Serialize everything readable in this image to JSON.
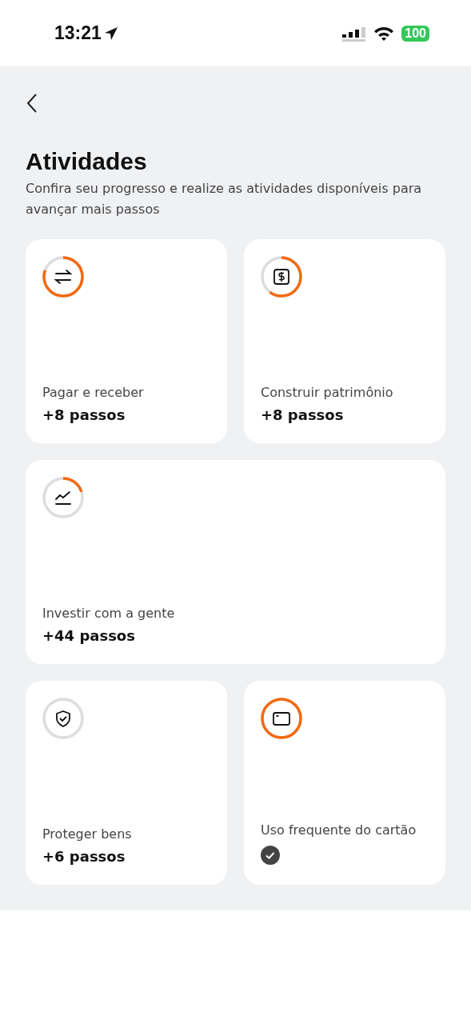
{
  "status_bar": {
    "time": "13:21",
    "battery": "100"
  },
  "header": {
    "title": "Atividades",
    "subtitle": "Confira seu progresso e realize as atividades disponíveis para avançar mais passos"
  },
  "activities": [
    {
      "kind": "transfer",
      "label": "Pagar e receber",
      "reward": "+8 passos",
      "wide": false,
      "completed": false
    },
    {
      "kind": "money",
      "label": "Construir patrimônio",
      "reward": "+8 passos",
      "wide": false,
      "completed": false
    },
    {
      "kind": "chart",
      "label": "Investir com a gente",
      "reward": "+44 passos",
      "wide": true,
      "completed": false
    },
    {
      "kind": "shield",
      "label": "Proteger bens",
      "reward": "+6 passos",
      "wide": false,
      "completed": false
    },
    {
      "kind": "card",
      "label": "Uso frequente do cartão",
      "wide": false,
      "completed": true
    }
  ]
}
